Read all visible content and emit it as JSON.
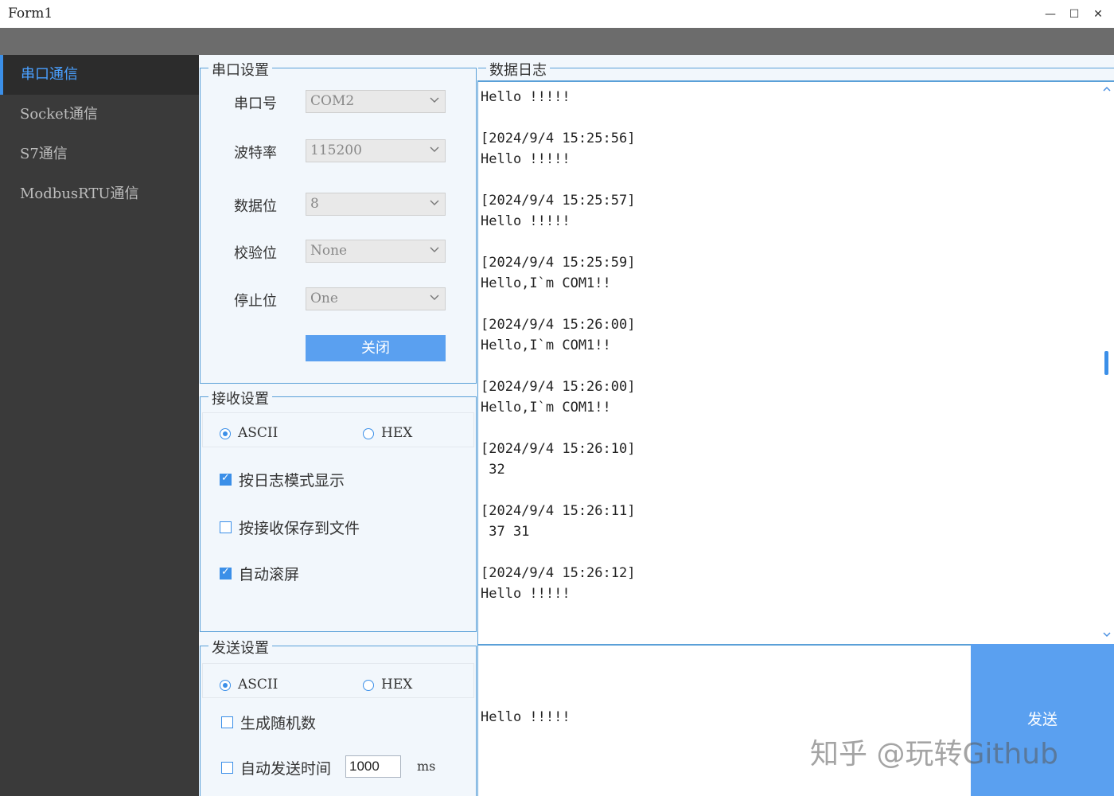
{
  "window": {
    "title": "Form1",
    "minimize": "—",
    "maximize": "☐",
    "close": "✕"
  },
  "sidebar": {
    "items": [
      {
        "label": "串口通信",
        "active": true
      },
      {
        "label": "Socket通信",
        "active": false
      },
      {
        "label": "S7通信",
        "active": false
      },
      {
        "label": "ModbusRTU通信",
        "active": false
      }
    ]
  },
  "serial_settings": {
    "legend": "串口设置",
    "port_label": "串口号",
    "port_value": "COM2",
    "baud_label": "波特率",
    "baud_value": "115200",
    "databits_label": "数据位",
    "databits_value": "8",
    "parity_label": "校验位",
    "parity_value": "None",
    "stopbits_label": "停止位",
    "stopbits_value": "One",
    "close_button": "关闭"
  },
  "receive_settings": {
    "legend": "接收设置",
    "ascii_label": "ASCII",
    "hex_label": "HEX",
    "mode": "ASCII",
    "log_mode_label": "按日志模式显示",
    "log_mode_checked": true,
    "save_file_label": "按接收保存到文件",
    "save_file_checked": false,
    "auto_scroll_label": "自动滚屏",
    "auto_scroll_checked": true
  },
  "send_settings": {
    "legend": "发送设置",
    "ascii_label": "ASCII",
    "hex_label": "HEX",
    "mode": "ASCII",
    "random_label": "生成随机数",
    "random_checked": false,
    "auto_send_label": "自动发送时间",
    "auto_send_checked": false,
    "interval_value": "1000",
    "interval_unit": "ms"
  },
  "data_log": {
    "legend": "数据日志",
    "text": "Hello !!!!!\n\n[2024/9/4 15:25:56]\nHello !!!!!\n\n[2024/9/4 15:25:57]\nHello !!!!!\n\n[2024/9/4 15:25:59]\nHello,I`m COM1!!\n\n[2024/9/4 15:26:00]\nHello,I`m COM1!!\n\n[2024/9/4 15:26:00]\nHello,I`m COM1!!\n\n[2024/9/4 15:26:10]\n 32\n\n[2024/9/4 15:26:11]\n 37 31\n\n[2024/9/4 15:26:12]\nHello !!!!!",
    "scroll_position": 0.5
  },
  "send_area": {
    "text": "Hello !!!!!",
    "button": "发送"
  },
  "watermark": "知乎 @玩转Github",
  "colors": {
    "accent": "#3b8fe8",
    "button": "#5aa0f0",
    "sidebar": "#3a3a3a"
  }
}
